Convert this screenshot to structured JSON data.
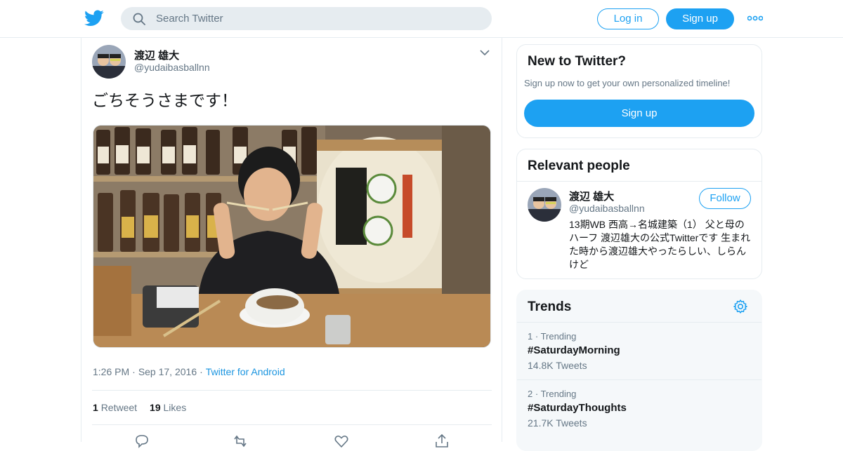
{
  "topbar": {
    "search_placeholder": "Search Twitter",
    "login_label": "Log in",
    "signup_label": "Sign up",
    "brand_color": "#1da1f2"
  },
  "tweet": {
    "author_name": "渡辺 雄大",
    "author_handle": "@yudaibasballnn",
    "text": "ごちそうさまです！",
    "time": "1:26 PM",
    "date": "Sep 17, 2016",
    "source": "Twitter for Android",
    "retweets_count": "1",
    "retweets_label": "Retweet",
    "likes_count": "19",
    "likes_label": "Likes",
    "photo": "photo"
  },
  "sidebar": {
    "new": {
      "title": "New to Twitter?",
      "subtitle": "Sign up now to get your own personalized timeline!",
      "signup_label": "Sign up"
    },
    "people": {
      "title": "Relevant people",
      "name": "渡辺 雄大",
      "handle": "@yudaibasballnn",
      "follow_label": "Follow",
      "bio": "13期WB 西高→名城建築（1） 父と母のハーフ 渡辺雄大の公式Twitterです 生まれた時から渡辺雄大やったらしい、しらんけど"
    },
    "trends": {
      "title": "Trends",
      "items": [
        {
          "rank": "1",
          "kind": "Trending",
          "tag": "#SaturdayMorning",
          "count": "14.8K Tweets"
        },
        {
          "rank": "2",
          "kind": "Trending",
          "tag": "#SaturdayThoughts",
          "count": "21.7K Tweets"
        }
      ]
    }
  }
}
